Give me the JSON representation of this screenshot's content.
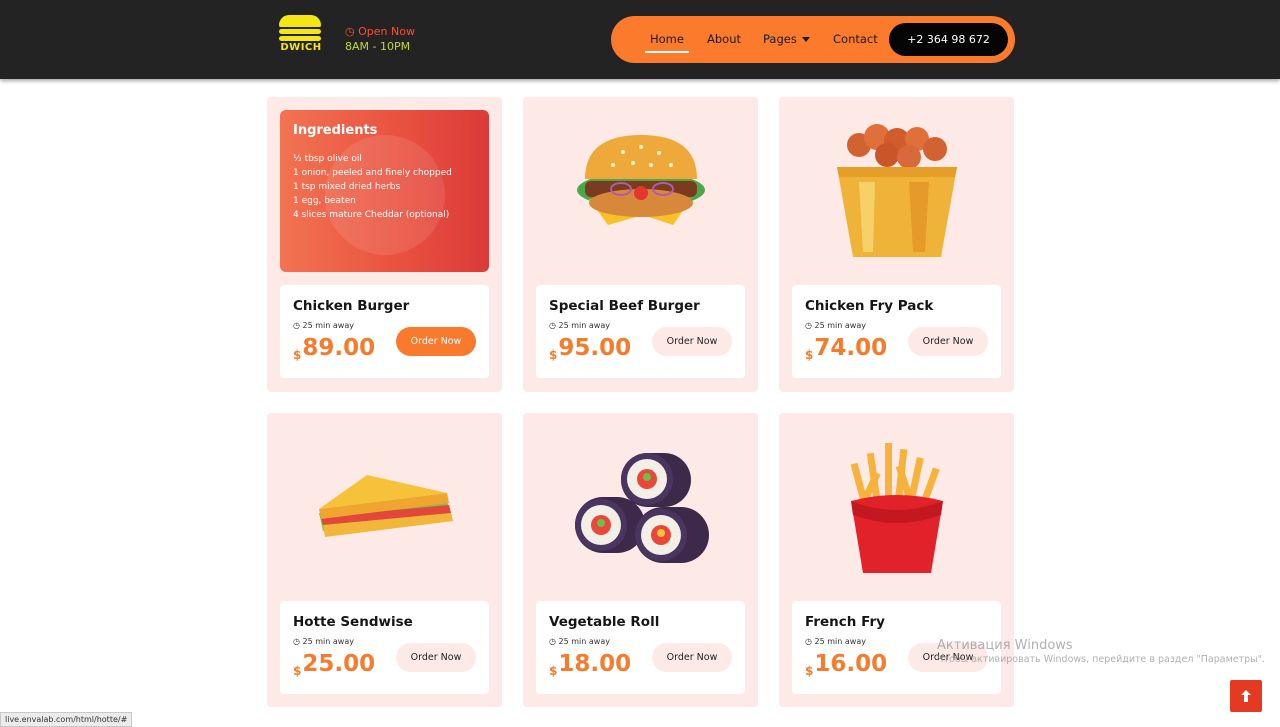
{
  "header": {
    "logo_text": "DWICH",
    "open_status": "Open Now",
    "hours": "8AM - 10PM",
    "nav": [
      "Home",
      "About",
      "Pages",
      "Contact"
    ],
    "phone": "+2 364 98 672"
  },
  "ingredients": {
    "title": "Ingredients",
    "items": [
      "½ tbsp olive oil",
      "1 onion, peeled and finely chopped",
      "1 tsp mixed dried herbs",
      "1 egg, beaten",
      "4 slices mature Cheddar (optional)"
    ]
  },
  "products": [
    {
      "name": "Chicken Burger",
      "time": "25 min away",
      "currency": "$",
      "price": "89.00",
      "button": "Order Now",
      "icon": "ingredients-card"
    },
    {
      "name": "Special Beef Burger",
      "time": "25 min away",
      "currency": "$",
      "price": "95.00",
      "button": "Order Now",
      "icon": "burger-icon"
    },
    {
      "name": "Chicken Fry Pack",
      "time": "25 min away",
      "currency": "$",
      "price": "74.00",
      "button": "Order Now",
      "icon": "chicken-bucket-icon"
    },
    {
      "name": "Hotte Sendwise",
      "time": "25 min away",
      "currency": "$",
      "price": "25.00",
      "button": "Order Now",
      "icon": "sandwich-icon"
    },
    {
      "name": "Vegetable Roll",
      "time": "25 min away",
      "currency": "$",
      "price": "18.00",
      "button": "Order Now",
      "icon": "sushi-roll-icon"
    },
    {
      "name": "French Fry",
      "time": "25 min away",
      "currency": "$",
      "price": "16.00",
      "button": "Order Now",
      "icon": "french-fries-icon"
    }
  ],
  "watermark": {
    "line1": "Активация Windows",
    "line2": "Чтобы активировать Windows, перейдите в раздел \"Параметры\"."
  },
  "status_url": "live.envalab.com/html/hotte/#",
  "colors": {
    "accent": "#fb7a2c",
    "header_bg": "#232323",
    "card_bg": "#fdeae6",
    "price": "#f77b2d"
  }
}
